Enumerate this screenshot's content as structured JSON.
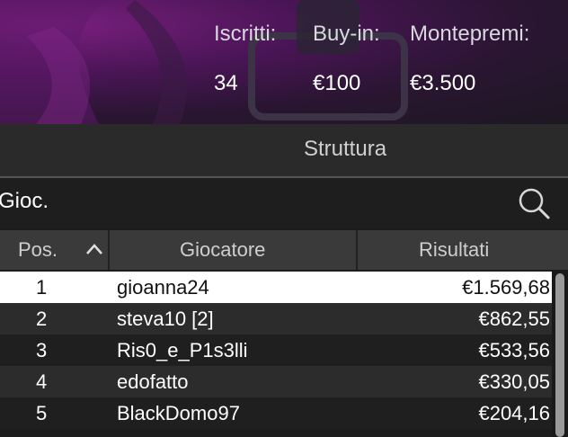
{
  "header": {
    "stats": [
      {
        "label": "Iscritti:",
        "value": "34"
      },
      {
        "label": "Buy-in:",
        "value": "€100"
      },
      {
        "label": "Montepremi:",
        "value": "€3.500"
      }
    ]
  },
  "tabs": {
    "active_label": "Struttura"
  },
  "search": {
    "text": "Gioc.",
    "icon": "search-icon"
  },
  "table": {
    "columns": [
      "Pos.",
      "Giocatore",
      "Risultati"
    ],
    "sort_icon": "chevron-up-icon",
    "rows": [
      {
        "pos": "1",
        "player": "gioanna24",
        "result": "€1.569,68"
      },
      {
        "pos": "2",
        "player": "steva10 [2]",
        "result": "€862,55"
      },
      {
        "pos": "3",
        "player": "Ris0_e_P1s3lli",
        "result": "€533,56"
      },
      {
        "pos": "4",
        "player": "edofatto",
        "result": "€330,05"
      },
      {
        "pos": "5",
        "player": "BlackDomo97",
        "result": "€204,16"
      }
    ]
  },
  "colors": {
    "selected_row": "#ffffff",
    "header_bg": "#3a3a3a"
  }
}
